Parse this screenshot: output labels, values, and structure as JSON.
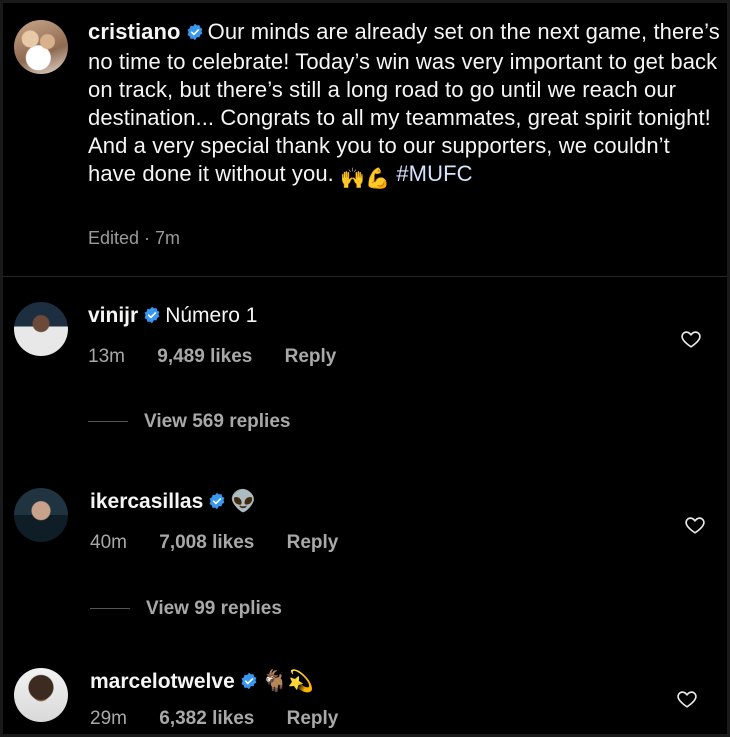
{
  "caption": {
    "username": "cristiano",
    "text_main": "Our minds are already set on the next game, there’s no time to celebrate! Today’s win was very important to get back on track, but there’s still a long road to go until we reach our destination... Congrats to all my teammates, great spirit tonight! And a very special thank you to our supporters, we couldn’t have done it without you.",
    "emojis": "🙌💪",
    "hashtag": "#MUFC",
    "edited": "Edited · 7m"
  },
  "comments": [
    {
      "username": "vinijr",
      "text": "Número 1",
      "time": "13m",
      "likes": "9,489 likes",
      "reply": "Reply",
      "view_replies": "View 569 replies"
    },
    {
      "username": "ikercasillas",
      "text": "👽",
      "time": "40m",
      "likes": "7,008 likes",
      "reply": "Reply",
      "view_replies": "View 99 replies"
    },
    {
      "username": "marcelotwelve",
      "text": "🐐💫",
      "time": "29m",
      "likes": "6,382 likes",
      "reply": "Reply"
    }
  ],
  "colors": {
    "background": "#000000",
    "text": "#f5f5f5",
    "muted": "#a8a8a8",
    "verified": "#3897f0"
  },
  "icons": [
    "verified-badge-icon",
    "heart-icon"
  ]
}
